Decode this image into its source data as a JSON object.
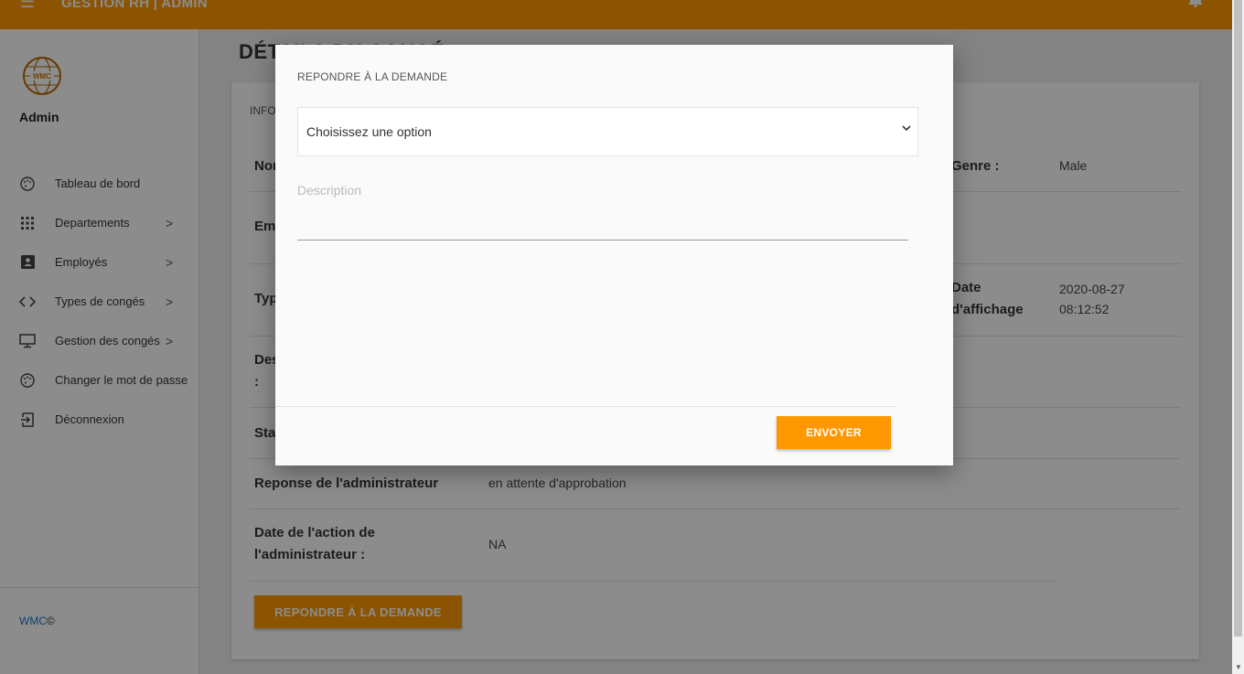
{
  "colors": {
    "accent": "#ff9800",
    "link": "#1976d2"
  },
  "topbar": {
    "menu_icon": "☰",
    "title": "GESTION RH | ADMIN",
    "notification_icon": "bell-icon"
  },
  "sidebar": {
    "logo_text": "WMC",
    "admin_name": "Admin",
    "items": [
      {
        "label": "Tableau de bord",
        "icon": "palette-icon",
        "has_chevron": false
      },
      {
        "label": "Departements",
        "icon": "apps-grid-icon",
        "has_chevron": true
      },
      {
        "label": "Employés",
        "icon": "account-box-icon",
        "has_chevron": true
      },
      {
        "label": "Types de congés",
        "icon": "code-icon",
        "has_chevron": true
      },
      {
        "label": "Gestion des congés",
        "icon": "desktop-icon",
        "has_chevron": true
      },
      {
        "label": "Changer le mot de passe",
        "icon": "palette-icon",
        "has_chevron": false
      },
      {
        "label": "Déconnexion",
        "icon": "logout-icon",
        "has_chevron": false
      }
    ],
    "chevron": ">",
    "footer_brand": "WMC",
    "footer_symbol": "©"
  },
  "main": {
    "title": "DÉTAILS DU CONGÉ",
    "card_head": "INFORMATIONS",
    "rows": {
      "name_key": "Nom",
      "gender_key": "Genre :",
      "gender_value": "Male",
      "email_key": "Email",
      "type_key": "Type",
      "posted_key_1": "Date",
      "posted_key_2": "d'affichage",
      "posted_value_1": "2020-08-27",
      "posted_value_2": "08:12:52",
      "desc_key_1": "Description",
      "desc_key_2": ":",
      "status_key": "Statut",
      "admin_response_key": "Reponse de l'administrateur",
      "admin_response_value": "en attente d'approbation",
      "admin_date_key_1": "Date de l'action de",
      "admin_date_key_2": "l'administrateur :",
      "admin_date_value": "NA"
    },
    "respond_button": "REPONDRE À LA DEMANDE"
  },
  "modal": {
    "title": "REPONDRE À LA DEMANDE",
    "select_value": "Choisissez une option",
    "description_placeholder": "Description",
    "send_button": "ENVOYER"
  }
}
